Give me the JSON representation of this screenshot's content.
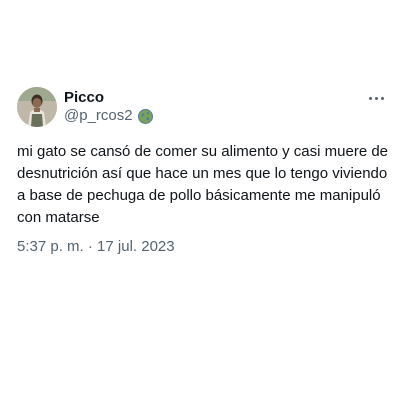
{
  "author": {
    "display_name": "Picco",
    "handle": "@p_rcos2",
    "avatar_icon": "user-photo",
    "badge_icon": "globe-badge-icon"
  },
  "menu_icon": "more-options-icon",
  "tweet": {
    "lines": [
      "mi gato se cansó de comer su alimento y casi muere de",
      "desnutrición así que hace un mes que lo tengo viviendo",
      "a base de pechuga de pollo básicamente me manipuló",
      "con matarse"
    ],
    "time": "5:37 p. m.",
    "separator": "·",
    "date": "17 jul. 2023"
  },
  "colors": {
    "text": "#0f1419",
    "muted": "#536471",
    "background": "#ffffff"
  }
}
